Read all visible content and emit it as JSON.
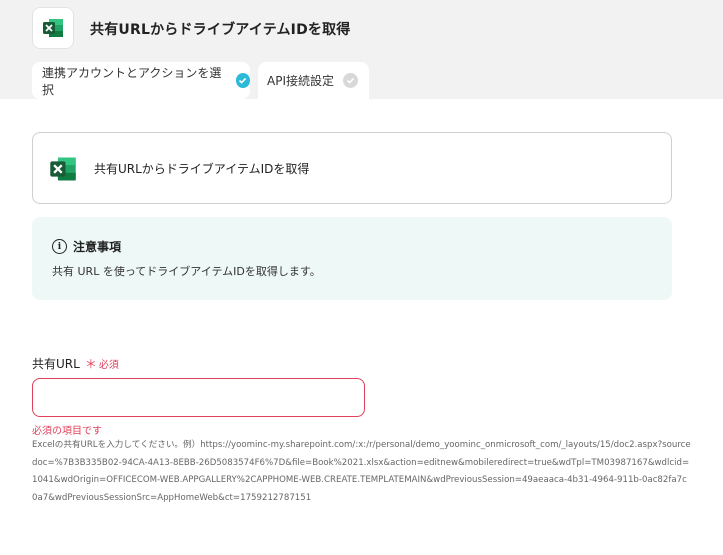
{
  "header": {
    "title": "共有URLからドライブアイテムIDを取得",
    "app_icon": "excel-icon"
  },
  "tabs": [
    {
      "label": "連携アカウントとアクションを選択",
      "status": "done"
    },
    {
      "label": "API接続設定",
      "status": "pending"
    }
  ],
  "action_card": {
    "label": "共有URLからドライブアイテムIDを取得",
    "icon": "excel-icon"
  },
  "notice": {
    "heading": "注意事項",
    "body": "共有 URL を使ってドライブアイテムIDを取得します。",
    "icon": "info-icon"
  },
  "form": {
    "url_field": {
      "label": "共有URL",
      "required_mark": "＊",
      "required_text": "必須",
      "value": "",
      "placeholder": "",
      "error": "必須の項目です",
      "help": "Excelの共有URLを入力してください。例）https://yoominc-my.sharepoint.com/:x:/r/personal/demo_yoominc_onmicrosoft_com/_layouts/15/doc2.aspx?sourcedoc=%7B3B335B02-94CA-4A13-8EBB-26D5083574F6%7D&file=Book%2021.xlsx&action=editnew&mobileredirect=true&wdTpl=TM03987167&wdlcid=1041&wdOrigin=OFFICECOM-WEB.APPGALLERY%2CAPPHOME-WEB.CREATE.TEMPLATEMAIN&wdPreviousSession=49aeaaca-4b31-4964-911b-0ac82fa7c0a7&wdPreviousSessionSrc=AppHomeWeb&ct=1759212787151"
    }
  },
  "colors": {
    "accent_check": "#2bbbd8",
    "error": "#e0405a",
    "notice_bg": "#eef8f7",
    "excel_green": "#1d6f42"
  }
}
